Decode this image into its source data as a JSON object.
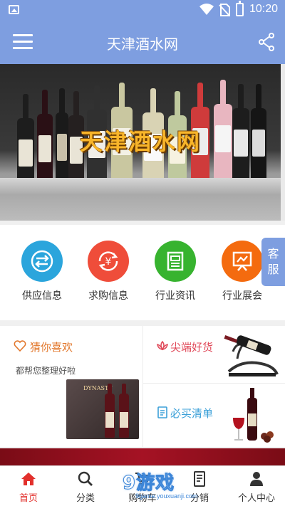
{
  "status_bar": {
    "time": "10:20"
  },
  "header": {
    "title": "天津酒水网"
  },
  "banner": {
    "caption": "天津酒水网"
  },
  "categories": [
    {
      "label": "供应信息",
      "icon": "exchange-icon",
      "color": "#2ba5dc"
    },
    {
      "label": "求购信息",
      "icon": "yen-cycle-icon",
      "color": "#ef4d3a"
    },
    {
      "label": "行业资讯",
      "icon": "news-icon",
      "color": "#37b32f"
    },
    {
      "label": "行业展会",
      "icon": "presentation-icon",
      "color": "#f46b0f"
    }
  ],
  "customer_service": {
    "label_line1": "客",
    "label_line2": "服"
  },
  "promo": {
    "guess": {
      "title": "猜你喜欢",
      "subtitle": "都帮您整理好啦",
      "box_brand": "DYNASTY"
    },
    "hot": {
      "title": "尖端好货"
    },
    "must_buy": {
      "title": "必买清单"
    }
  },
  "bottom_nav": [
    {
      "label": "首页",
      "icon": "home-icon",
      "active": true
    },
    {
      "label": "分类",
      "icon": "search-icon",
      "active": false
    },
    {
      "label": "购物车",
      "icon": "cart-icon",
      "active": false
    },
    {
      "label": "分销",
      "icon": "document-icon",
      "active": false
    },
    {
      "label": "个人中心",
      "icon": "user-icon",
      "active": false
    }
  ],
  "watermark": {
    "text": "9游戏",
    "sub": "9game.youxuanji.com"
  },
  "colors": {
    "header": "#7e9ee0",
    "active_nav": "#e2302c",
    "strip": "#a51224"
  }
}
